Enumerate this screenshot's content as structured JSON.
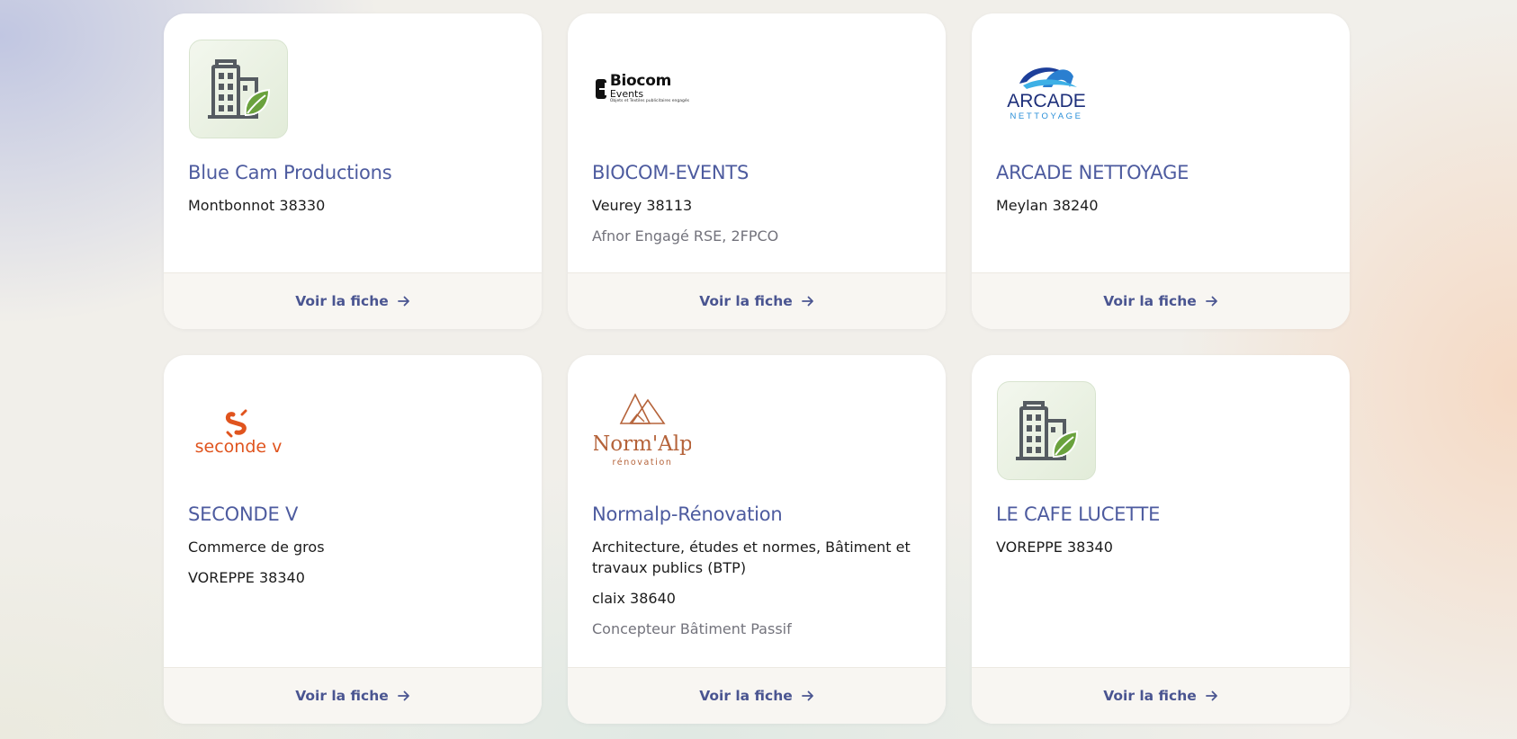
{
  "cards": [
    {
      "name": "Blue Cam Productions",
      "lines": [
        "Montbonnot 38330"
      ],
      "muted": "",
      "logo": "building-leaf-icon",
      "cta": "Voir la fiche"
    },
    {
      "name": "BIOCOM-EVENTS",
      "lines": [
        "Veurey 38113"
      ],
      "muted": "Afnor Engagé RSE, 2FPCO",
      "logo": "biocom-events-logo",
      "logo_text": {
        "t1": "Biocom",
        "t2": "Events",
        "t3": "Objets et Textiles publicitaires engagés"
      },
      "cta": "Voir la fiche"
    },
    {
      "name": "ARCADE NETTOYAGE",
      "lines": [
        "Meylan 38240"
      ],
      "muted": "",
      "logo": "arcade-nettoyage-logo",
      "logo_text": {
        "t1": "ARCADE",
        "t2": "NETTOYAGE"
      },
      "cta": "Voir la fiche"
    },
    {
      "name": "SECONDE V",
      "lines": [
        "Commerce de gros",
        "VOREPPE 38340"
      ],
      "muted": "",
      "logo": "seconde-v-logo",
      "logo_text": {
        "t1": "seconde v"
      },
      "cta": "Voir la fiche"
    },
    {
      "name": "Normalp-Rénovation",
      "lines": [
        "Architecture, études et normes, Bâtiment et travaux publics (BTP)",
        "claix 38640"
      ],
      "muted": "Concepteur Bâtiment Passif",
      "logo": "normalp-renovation-logo",
      "logo_text": {
        "t1": "Norm'Alp",
        "t2": "rénovation"
      },
      "cta": "Voir la fiche"
    },
    {
      "name": "LE CAFE LUCETTE",
      "lines": [
        "VOREPPE 38340"
      ],
      "muted": "",
      "logo": "building-leaf-icon",
      "cta": "Voir la fiche"
    }
  ],
  "colors": {
    "title": "#4d5b9f",
    "link": "#4a5591",
    "text": "#1c1c1c",
    "muted": "#73737c",
    "footer_bg": "#f8f6f2"
  }
}
